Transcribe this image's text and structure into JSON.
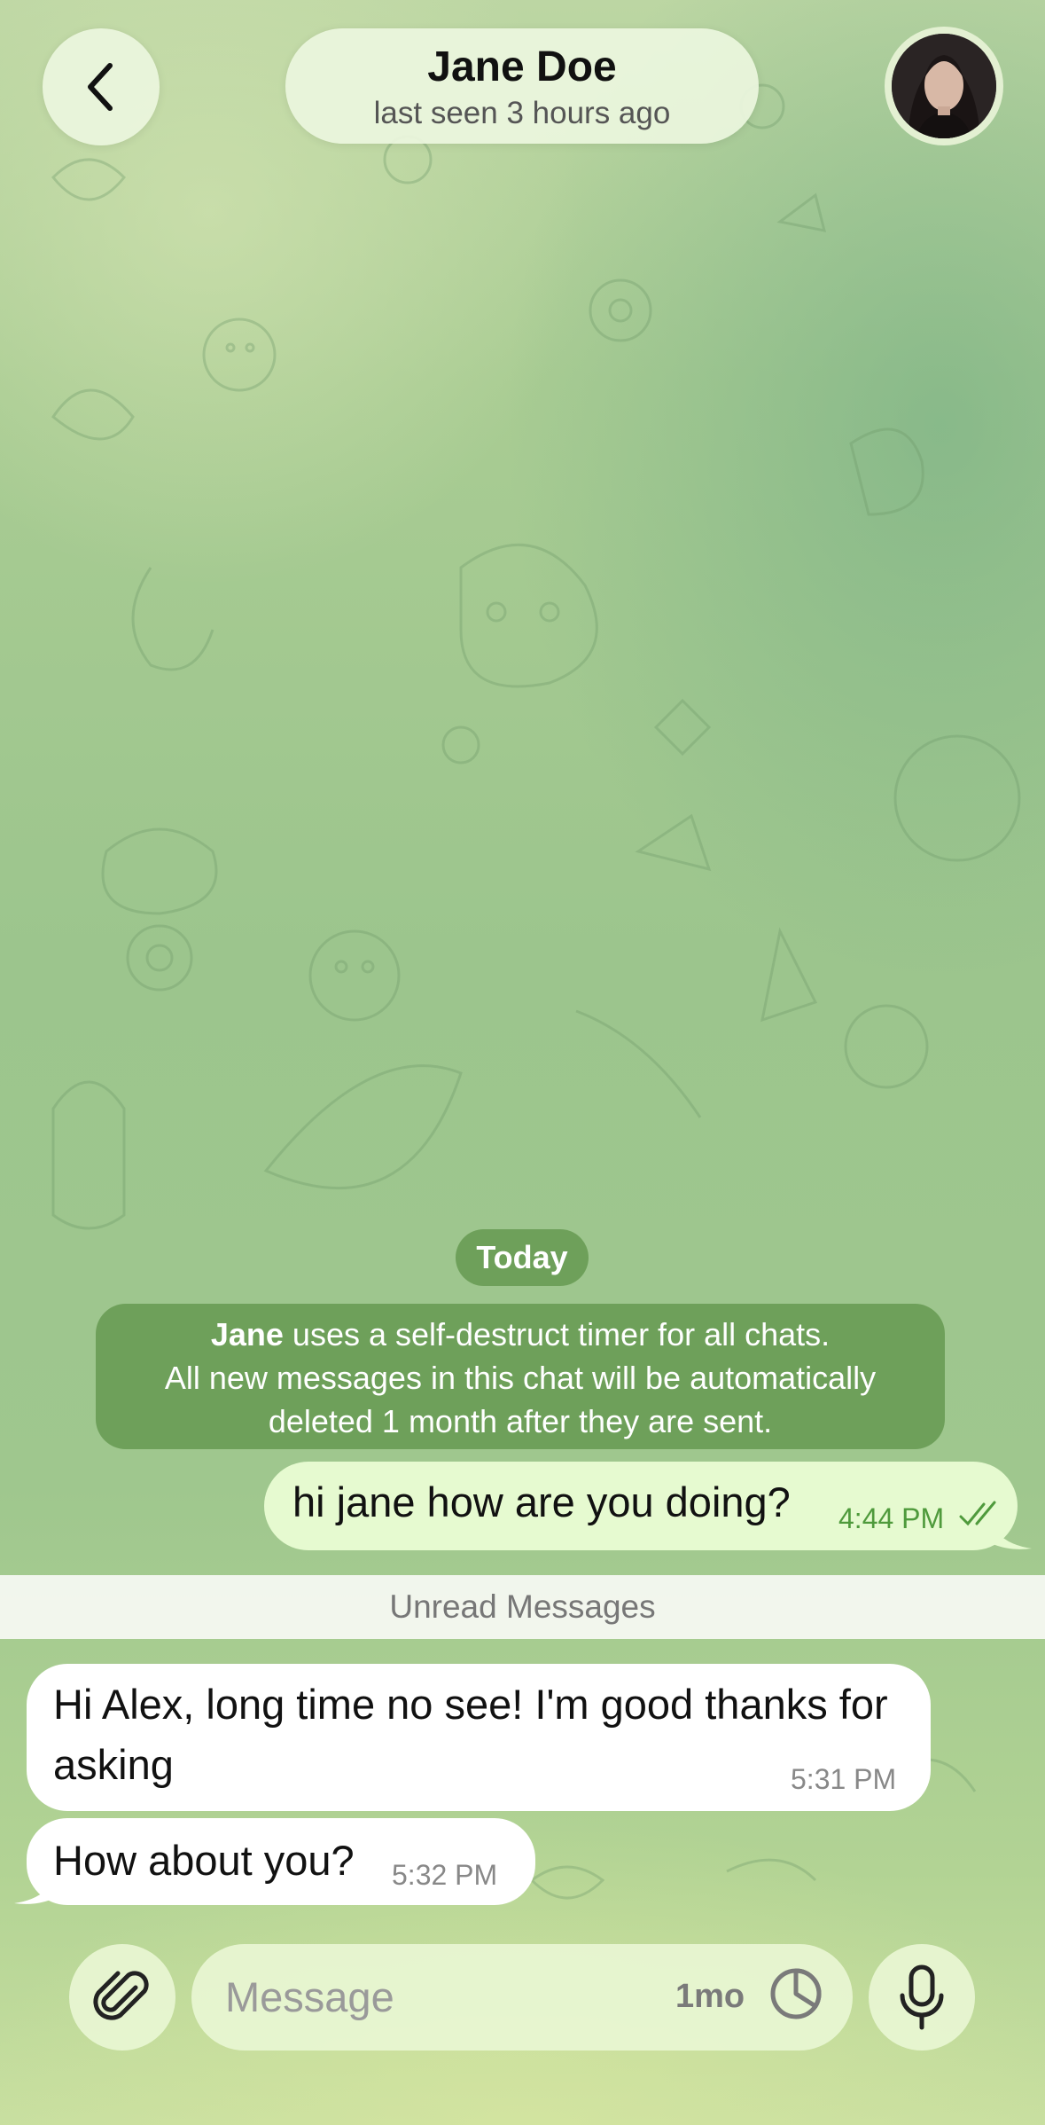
{
  "header": {
    "back_icon": "chevron-left-icon",
    "contact_name": "Jane Doe",
    "contact_status": "last seen 3 hours ago",
    "avatar": "contact-avatar-photo"
  },
  "chat": {
    "date_chip": "Today",
    "service_message": {
      "name": "Jane",
      "line1_rest": " uses a self-destruct timer for all chats.",
      "line2": "All new messages in this chat will be automatically",
      "line3": "deleted 1 month after they are sent."
    },
    "outgoing": [
      {
        "text": "hi jane how are you doing?",
        "time": "4:44 PM",
        "status": "read-double-check"
      }
    ],
    "unread_divider": "Unread Messages",
    "incoming": [
      {
        "text": "Hi Alex, long time no see! I'm good thanks for asking",
        "time": "5:31 PM"
      },
      {
        "text": "How about you?",
        "time": "5:32 PM"
      }
    ]
  },
  "composer": {
    "attach_icon": "paperclip-icon",
    "placeholder": "Message",
    "timer_label": "1mo",
    "timer_icon": "timer-icon",
    "mic_icon": "microphone-icon"
  },
  "colors": {
    "service_bg": "#6ea05a",
    "outgoing_bubble": "#e6fad0",
    "outgoing_time": "#4f9a3c",
    "incoming_bubble": "#ffffff",
    "control_bg": "#e8f5d2"
  }
}
